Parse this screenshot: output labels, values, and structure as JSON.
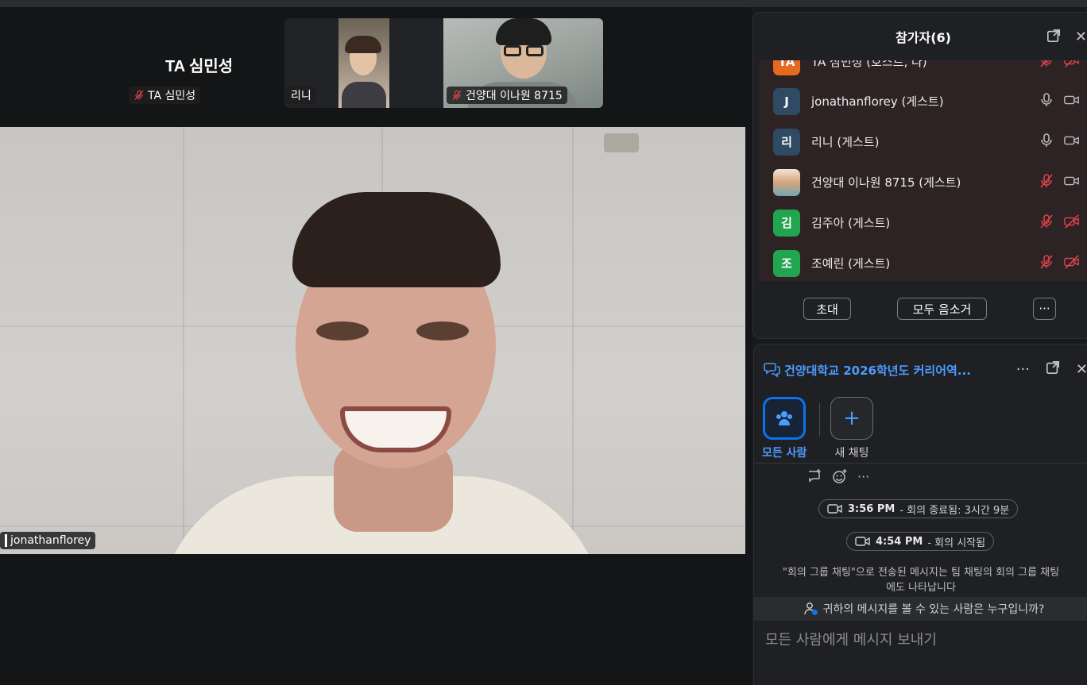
{
  "video": {
    "ta_tile": {
      "title": "TA 심민성",
      "chip": "TA 심민성"
    },
    "rini_tile": {
      "chip": "리니"
    },
    "kyy_tile": {
      "chip": "건양대 이나원 8715"
    },
    "main": {
      "chip": "jonathanflorey"
    }
  },
  "participants": {
    "title": "참가자(6)",
    "rows": [
      {
        "initial": "TA",
        "name": "TA 심민성 (호스트, 나)",
        "avatar_color": "#e56a1f",
        "mic": "muted",
        "cam": "muted"
      },
      {
        "initial": "J",
        "name": "jonathanflorey (게스트)",
        "avatar_color": "#2f4a63",
        "mic": "on",
        "cam": "on"
      },
      {
        "initial": "리",
        "name": "리니 (게스트)",
        "avatar_color": "#2f4a63",
        "mic": "on",
        "cam": "on"
      },
      {
        "initial": "",
        "name": "건양대 이나원 8715 (게스트)",
        "avatar_color": "#c9a06c",
        "mic": "muted",
        "cam": "on"
      },
      {
        "initial": "김",
        "name": "김주아 (게스트)",
        "avatar_color": "#21a64f",
        "mic": "muted",
        "cam": "muted"
      },
      {
        "initial": "조",
        "name": "조예린 (게스트)",
        "avatar_color": "#21a64f",
        "mic": "muted",
        "cam": "muted"
      }
    ],
    "invite_label": "초대",
    "mute_all_label": "모두 음소거",
    "more_label": "···"
  },
  "chat": {
    "title": "건양대학교 2026학년도 커리어역...",
    "more_label": "···",
    "channels": [
      {
        "label": "모든 사람",
        "active": true
      },
      {
        "label": "새 채팅",
        "active": false
      }
    ],
    "react_more": "···",
    "events": [
      {
        "time": "3:56 PM",
        "text": "- 회의 종료됨: 3시간 9분"
      },
      {
        "time": "4:54 PM",
        "text": "- 회의 시작됨"
      }
    ],
    "notice": "\"회의 그룹 채팅\"으로 전송된 메시지는 팀 채팅의 회의 그룹 채팅에도 나타납니다",
    "who_can_see": "귀하의 메시지를 볼 수 있는 사람은 누구입니까?",
    "composer_placeholder": "모든 사람에게 메시지 보내기"
  },
  "colors": {
    "accent": "#0e72ed",
    "accent_text": "#4d9bff",
    "muted_red": "#e0434b",
    "panel_bg": "#1f2024"
  }
}
